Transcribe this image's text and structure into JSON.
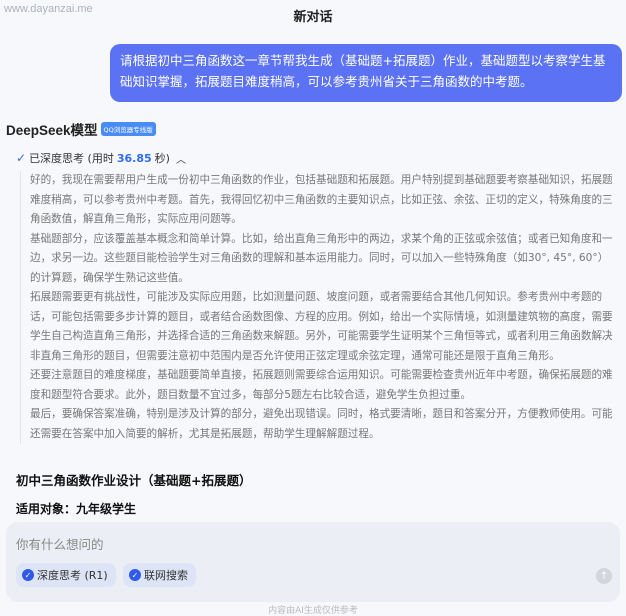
{
  "watermark": "www.dayanzai.me",
  "header": {
    "title": "新对话"
  },
  "user_message": "请根据初中三角函数这一章节帮我生成（基础题+拓展题）作业，基础题型以考察学生基础知识掌握，拓展题目难度稍高，可以参考贵州省关于三角函数的中考题。",
  "model": {
    "name": "DeepSeek模型",
    "badge": "QQ浏览器专线版"
  },
  "thinking": {
    "prefix": "已深度思考 (用时 ",
    "time": "36.85",
    "suffix": " 秒)",
    "paragraphs": [
      "好的，我现在需要帮用户生成一份初中三角函数的作业，包括基础题和拓展题。用户特别提到基础题要考察基础知识，拓展题难度稍高，可以参考贵州中考题。首先，我得回忆初中三角函数的主要知识点，比如正弦、余弦、正切的定义，特殊角度的三角函数值，解直角三角形，实际应用问题等。",
      "基础题部分，应该覆盖基本概念和简单计算。比如，给出直角三角形中的两边，求某个角的正弦或余弦值；或者已知角度和一边，求另一边。这些题目能检验学生对三角函数的理解和基本运用能力。同时，可以加入一些特殊角度（如30°, 45°, 60°）的计算题，确保学生熟记这些值。",
      "拓展题需要更有挑战性，可能涉及实际应用题，比如测量问题、坡度问题，或者需要结合其他几何知识。参考贵州中考题的话，可能包括需要多步计算的题目，或者结合函数图像、方程的应用。例如，给出一个实际情境，如测量建筑物的高度，需要学生自己构造直角三角形，并选择合适的三角函数来解题。另外，可能需要学生证明某个三角恒等式，或者利用三角函数解决非直角三角形的题目，但需要注意初中范围内是否允许使用正弦定理或余弦定理，通常可能还是限于直角三角形。",
      "还要注意题目的难度梯度，基础题要简单直接，拓展题则需要综合运用知识。可能需要检查贵州近年中考题，确保拓展题的难度和题型符合要求。此外，题目数量不宜过多，每部分5题左右比较合适，避免学生负担过重。",
      "最后，要确保答案准确，特别是涉及计算的部分，避免出现错误。同时，格式要清晰，题目和答案分开，方便教师使用。可能还需要在答案中加入简要的解析，尤其是拓展题，帮助学生理解解题过程。"
    ]
  },
  "answer": {
    "heading": "初中三角函数作业设计（基础题+拓展题）",
    "audience": "适用对象：九年级学生"
  },
  "composer": {
    "placeholder": "你有什么想问的",
    "chips": [
      "深度思考 (R1)",
      "联网搜索"
    ]
  },
  "footer": "内容由AI生成仅供参考",
  "colors": {
    "accent": "#5b72f5",
    "link": "#2f6df6"
  }
}
